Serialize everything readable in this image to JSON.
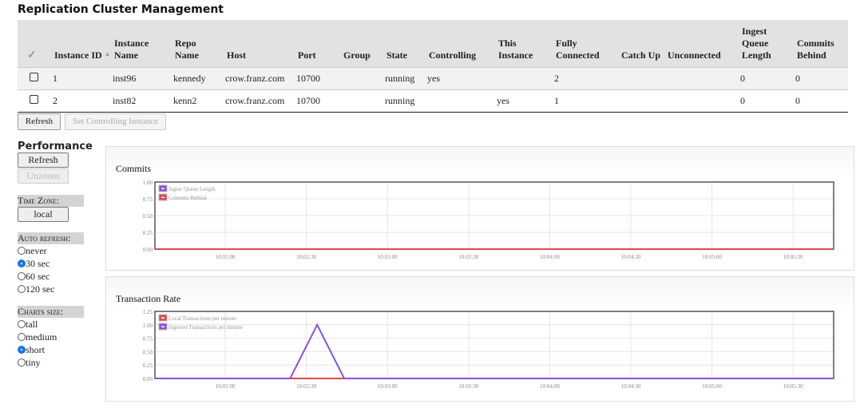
{
  "title": "Replication Cluster Management",
  "table": {
    "columns": [
      "Instance ID",
      "Instance Name",
      "Repo Name",
      "Host",
      "Port",
      "Group",
      "State",
      "Controlling",
      "This Instance",
      "Fully Connected",
      "Catch Up",
      "Unconnected",
      "Ingest Queue Length",
      "Commits Behind"
    ],
    "sorted_column": "Instance ID",
    "rows": [
      [
        "1",
        "inst96",
        "kennedy",
        "crow.franz.com",
        "10700",
        "",
        "running",
        "yes",
        "",
        "2",
        "",
        "",
        "0",
        "0"
      ],
      [
        "2",
        "inst82",
        "kenn2",
        "crow.franz.com",
        "10700",
        "",
        "running",
        "",
        "yes",
        "1",
        "",
        "",
        "0",
        "0"
      ]
    ]
  },
  "buttons": {
    "refresh": "Refresh",
    "set_controlling": "Set Controlling Instance"
  },
  "performance": {
    "title": "Performance",
    "refresh": "Refresh",
    "unzoom": "Unzoom",
    "time_zone_label": "Time Zone:",
    "time_zone": "local",
    "auto_refresh_label": "Auto refresh:",
    "auto_refresh_options": [
      "never",
      "30 sec",
      "60 sec",
      "120 sec"
    ],
    "auto_refresh_selected": "30 sec",
    "charts_size_label": "Charts size:",
    "charts_size_options": [
      "tall",
      "medium",
      "short",
      "tiny"
    ],
    "charts_size_selected": "short"
  },
  "chart_data": [
    {
      "type": "line",
      "title": "Commits",
      "ylim": [
        0,
        1
      ],
      "yticks": [
        "0.00",
        "0.25",
        "0.50",
        "0.75",
        "1.00"
      ],
      "xlim": [
        "10:01:34",
        "10:05:45"
      ],
      "xticks": [
        "10:02:00",
        "10:02:30",
        "10:03:00",
        "10:03:30",
        "10:04:00",
        "10:04:30",
        "10:05:00",
        "10:05:30"
      ],
      "legend": "top-left",
      "grid": true,
      "series": [
        {
          "name": "Ingest Queue Length",
          "color": "#8a4fe0",
          "x": [
            "10:01:34",
            "10:05:45"
          ],
          "y": [
            0,
            0
          ]
        },
        {
          "name": "Commits Behind",
          "color": "#e04848",
          "x": [
            "10:01:34",
            "10:05:45"
          ],
          "y": [
            0,
            0
          ]
        }
      ]
    },
    {
      "type": "line",
      "title": "Transaction Rate",
      "ylim": [
        0,
        1.25
      ],
      "yticks": [
        "0.00",
        "0.25",
        "0.50",
        "0.75",
        "1.00",
        "1.25"
      ],
      "xlim": [
        "10:01:34",
        "10:05:45"
      ],
      "xticks": [
        "10:02:00",
        "10:02:30",
        "10:03:00",
        "10:03:30",
        "10:04:00",
        "10:04:30",
        "10:05:00",
        "10:05:30"
      ],
      "legend": "top-left",
      "grid": true,
      "series": [
        {
          "name": "Local Transactions per minute",
          "color": "#e04848",
          "x": [
            "10:01:34",
            "10:05:45"
          ],
          "y": [
            0,
            0
          ]
        },
        {
          "name": "Ingested Transactions per minute",
          "color": "#8a4fe0",
          "x": [
            "10:01:34",
            "10:02:24",
            "10:02:34",
            "10:02:44",
            "10:05:45"
          ],
          "y": [
            0,
            0,
            1,
            0,
            0
          ]
        }
      ]
    }
  ]
}
